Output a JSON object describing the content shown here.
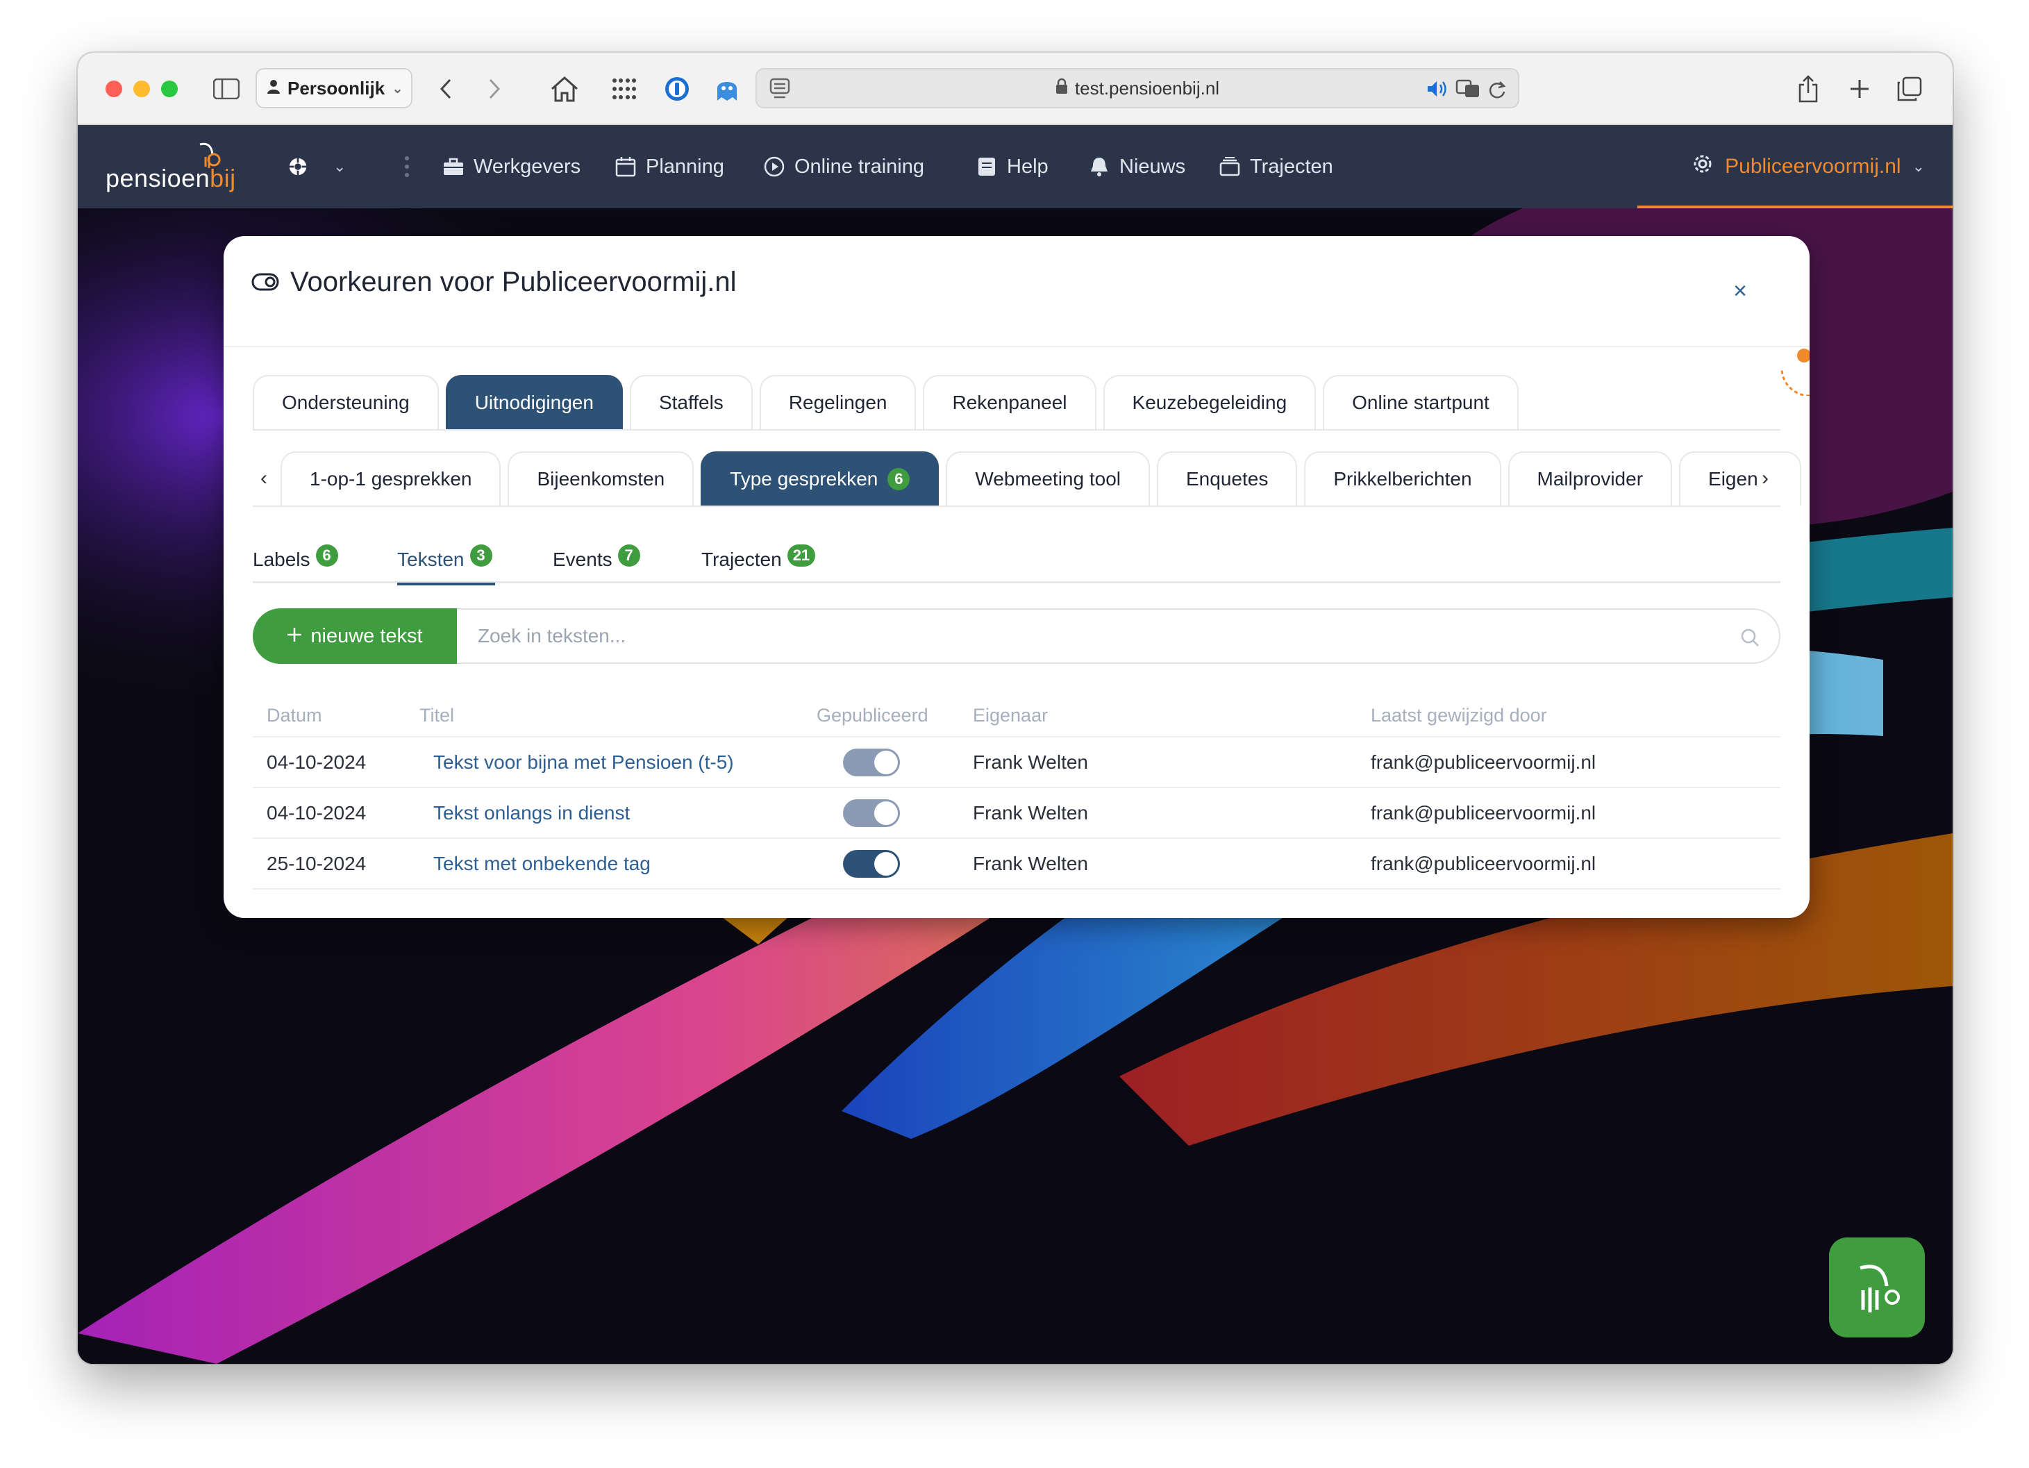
{
  "browser": {
    "profile_label": "Persoonlijk",
    "url": "test.pensioenbij.nl"
  },
  "app": {
    "brand_main": "pensioen",
    "brand_accent": "bij",
    "nav": [
      {
        "label": "Werkgevers",
        "icon": "briefcase-icon"
      },
      {
        "label": "Planning",
        "icon": "calendar-icon"
      },
      {
        "label": "Online training",
        "icon": "play-circle-icon"
      },
      {
        "label": "Help",
        "icon": "book-icon"
      },
      {
        "label": "Nieuws",
        "icon": "bell-icon"
      },
      {
        "label": "Trajecten",
        "icon": "stack-icon"
      }
    ],
    "account_label": "Publiceervoormij.nl",
    "accent_color": "#f08a2e",
    "nav_bg": "#2b3448"
  },
  "modal": {
    "title": "Voorkeuren voor Publiceervoormij.nl",
    "close_label": "×",
    "tabs": [
      {
        "label": "Ondersteuning"
      },
      {
        "label": "Uitnodigingen",
        "active": true
      },
      {
        "label": "Staffels"
      },
      {
        "label": "Regelingen"
      },
      {
        "label": "Rekenpaneel"
      },
      {
        "label": "Keuzebegeleiding"
      },
      {
        "label": "Online startpunt"
      }
    ],
    "subtabs_row2": [
      {
        "label": "1-op-1 gesprekken"
      },
      {
        "label": "Bijeenkomsten"
      },
      {
        "label": "Type gesprekken",
        "badge": "6",
        "active": true
      },
      {
        "label": "Webmeeting tool"
      },
      {
        "label": "Enquetes"
      },
      {
        "label": "Prikkelberichten"
      },
      {
        "label": "Mailprovider"
      },
      {
        "label": "Eigen"
      }
    ],
    "subtabs_row3": [
      {
        "label": "Labels",
        "badge": "6"
      },
      {
        "label": "Teksten",
        "badge": "3",
        "active": true
      },
      {
        "label": "Events",
        "badge": "7"
      },
      {
        "label": "Trajecten",
        "badge": "21"
      }
    ],
    "new_button": "nieuwe tekst",
    "search_placeholder": "Zoek in teksten...",
    "table": {
      "headers": [
        "Datum",
        "Titel",
        "Gepubliceerd",
        "Eigenaar",
        "Laatst gewijzigd door"
      ],
      "rows": [
        {
          "date": "04-10-2024",
          "title": "Tekst voor bijna met Pensioen (t-5)",
          "published": true,
          "owner": "Frank Welten",
          "modified_by": "frank@publiceervoormij.nl"
        },
        {
          "date": "04-10-2024",
          "title": "Tekst onlangs in dienst",
          "published": true,
          "owner": "Frank Welten",
          "modified_by": "frank@publiceervoormij.nl"
        },
        {
          "date": "25-10-2024",
          "title": "Tekst met onbekende tag",
          "published": true,
          "owner": "Frank Welten",
          "modified_by": "frank@publiceervoormij.nl"
        }
      ]
    }
  },
  "colors": {
    "primary": "#2e5176",
    "success": "#3f9d3f",
    "link": "#2e5f93"
  }
}
